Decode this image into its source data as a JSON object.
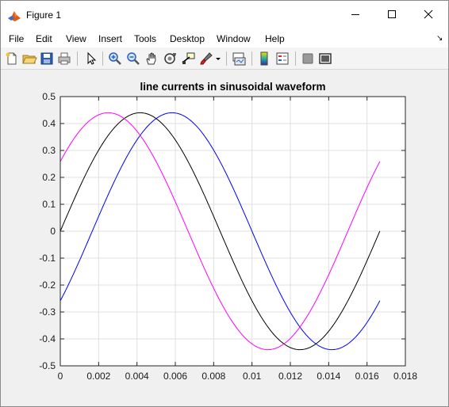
{
  "window": {
    "title": "Figure 1"
  },
  "menu": [
    "File",
    "Edit",
    "View",
    "Insert",
    "Tools",
    "Desktop",
    "Window",
    "Help"
  ],
  "toolbar": {
    "icons": [
      "new-figure-icon",
      "open-file-icon",
      "save-icon",
      "print-icon",
      "pointer-arrow-icon",
      "zoom-in-icon",
      "zoom-out-icon",
      "pan-hand-icon",
      "rotate-3d-icon",
      "data-cursor-icon",
      "brush-icon",
      "brush-dropdown-icon",
      "link-plot-icon",
      "colorbar-icon",
      "legend-icon",
      "hide-plot-tools-icon",
      "show-plot-tools-icon"
    ]
  },
  "chart_data": {
    "type": "line",
    "title": "line currents in sinusoidal waveform",
    "xlabel": "",
    "ylabel": "",
    "xlim": [
      0,
      0.018
    ],
    "ylim": [
      -0.5,
      0.5
    ],
    "xticks": [
      "0",
      "0.002",
      "0.004",
      "0.006",
      "0.008",
      "0.01",
      "0.012",
      "0.014",
      "0.016",
      "0.018"
    ],
    "yticks": [
      "0.5",
      "0.4",
      "0.3",
      "0.2",
      "0.1",
      "0",
      "-0.1",
      "-0.2",
      "-0.3",
      "-0.4",
      "-0.5"
    ],
    "grid": true,
    "series": [
      {
        "color": "#000000",
        "amplitude": 0.44,
        "frequency_hz": 60,
        "phase_deg": 0,
        "x_range": [
          0,
          0.01667
        ]
      },
      {
        "color": "#0000ff",
        "amplitude": 0.44,
        "frequency_hz": 60,
        "phase_deg": -36,
        "x_range": [
          0,
          0.01667
        ]
      },
      {
        "color": "#ff00ff",
        "amplitude": 0.44,
        "frequency_hz": 60,
        "phase_deg": 36,
        "x_range": [
          0,
          0.01667
        ]
      }
    ]
  },
  "colors": {
    "axes_background": "#ffffff",
    "grid": "#e0e0e0",
    "figure_background": "#f0f0f0"
  }
}
